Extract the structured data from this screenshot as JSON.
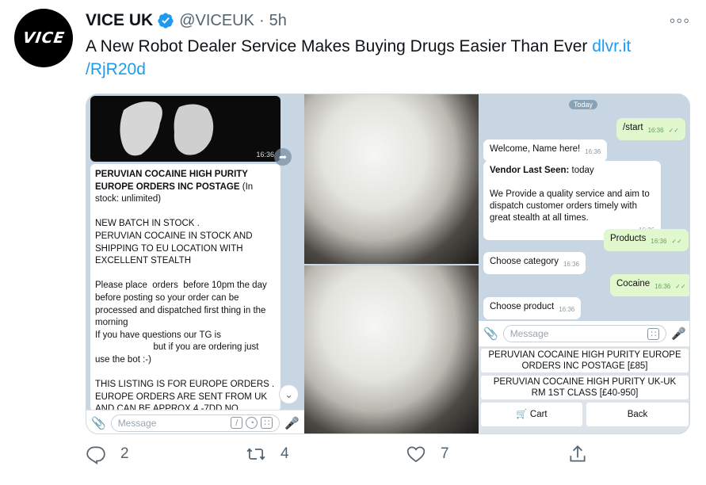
{
  "author": {
    "avatar_text": "VICE",
    "name": "VICE UK",
    "handle": "@VICEUK",
    "separator": "·",
    "time": "5h",
    "more_icon": "more-horizontal-icon"
  },
  "tweet": {
    "text": "A New Robot Dealer Service Makes Buying Drugs Easier Than Ever ",
    "link_part1": "dlvr.it",
    "link_part2": "/RjR20d"
  },
  "panel1": {
    "photo_time": "16:36",
    "message_title": "PERUVIAN COCAINE                    HIGH PURITY EUROPE ORDERS INC POSTAGE",
    "message_stock": " (In stock: unlimited)",
    "para1": "NEW BATCH IN STOCK .\nPERUVIAN COCAINE IN STOCK AND SHIPPING TO EU LOCATION WITH EXCELLENT STEALTH",
    "para2": "Please place  orders  before 10pm the day before posting so your order can be processed and dispatched first thing in the morning\nIf you have questions our TG is\n                       but if you are ordering just use the bot :-)",
    "para3": "THIS LISTING IS FOR EUROPE ORDERS  .\nEUROPE ORDERS ARE SENT FROM UK AND CAN BE APPROX 4 -7DD NO",
    "input_placeholder": "Message"
  },
  "panel3": {
    "today": "Today",
    "start": "/start",
    "start_time": "16:36",
    "welcome": "Welcome, Name here!",
    "welcome_time": "16:36",
    "vendor_label": "Vendor Last Seen:",
    "vendor_value": " today",
    "vendor_body": "We Provide a quality service and aim to dispatch customer orders timely with great stealth at all times.",
    "vendor_time": "16:36",
    "products": "Products",
    "products_time": "16:36",
    "choose_category": "Choose category",
    "choose_category_time": "16:36",
    "cocaine": "Cocaine",
    "cocaine_time": "16:36",
    "choose_product": "Choose product",
    "choose_product_time": "16:36",
    "input_placeholder": "Message",
    "kbd_option1": "PERUVIAN COCAINE                    HIGH PURITY EUROPE ORDERS INC POSTAGE [£85]",
    "kbd_option2": "PERUVIAN COCAINE HIGH PURITY UK-UK RM 1ST CLASS [£40-950]",
    "kbd_cart": "🛒 Cart",
    "kbd_back": "Back"
  },
  "actions": {
    "reply_count": "2",
    "retweet_count": "4",
    "like_count": "7"
  },
  "colors": {
    "link": "#1d9bf0",
    "verified": "#1d9bf0",
    "muted": "#536471",
    "telegram_bg": "#c7d6e2",
    "outgoing_bubble": "#e1f7cd"
  }
}
